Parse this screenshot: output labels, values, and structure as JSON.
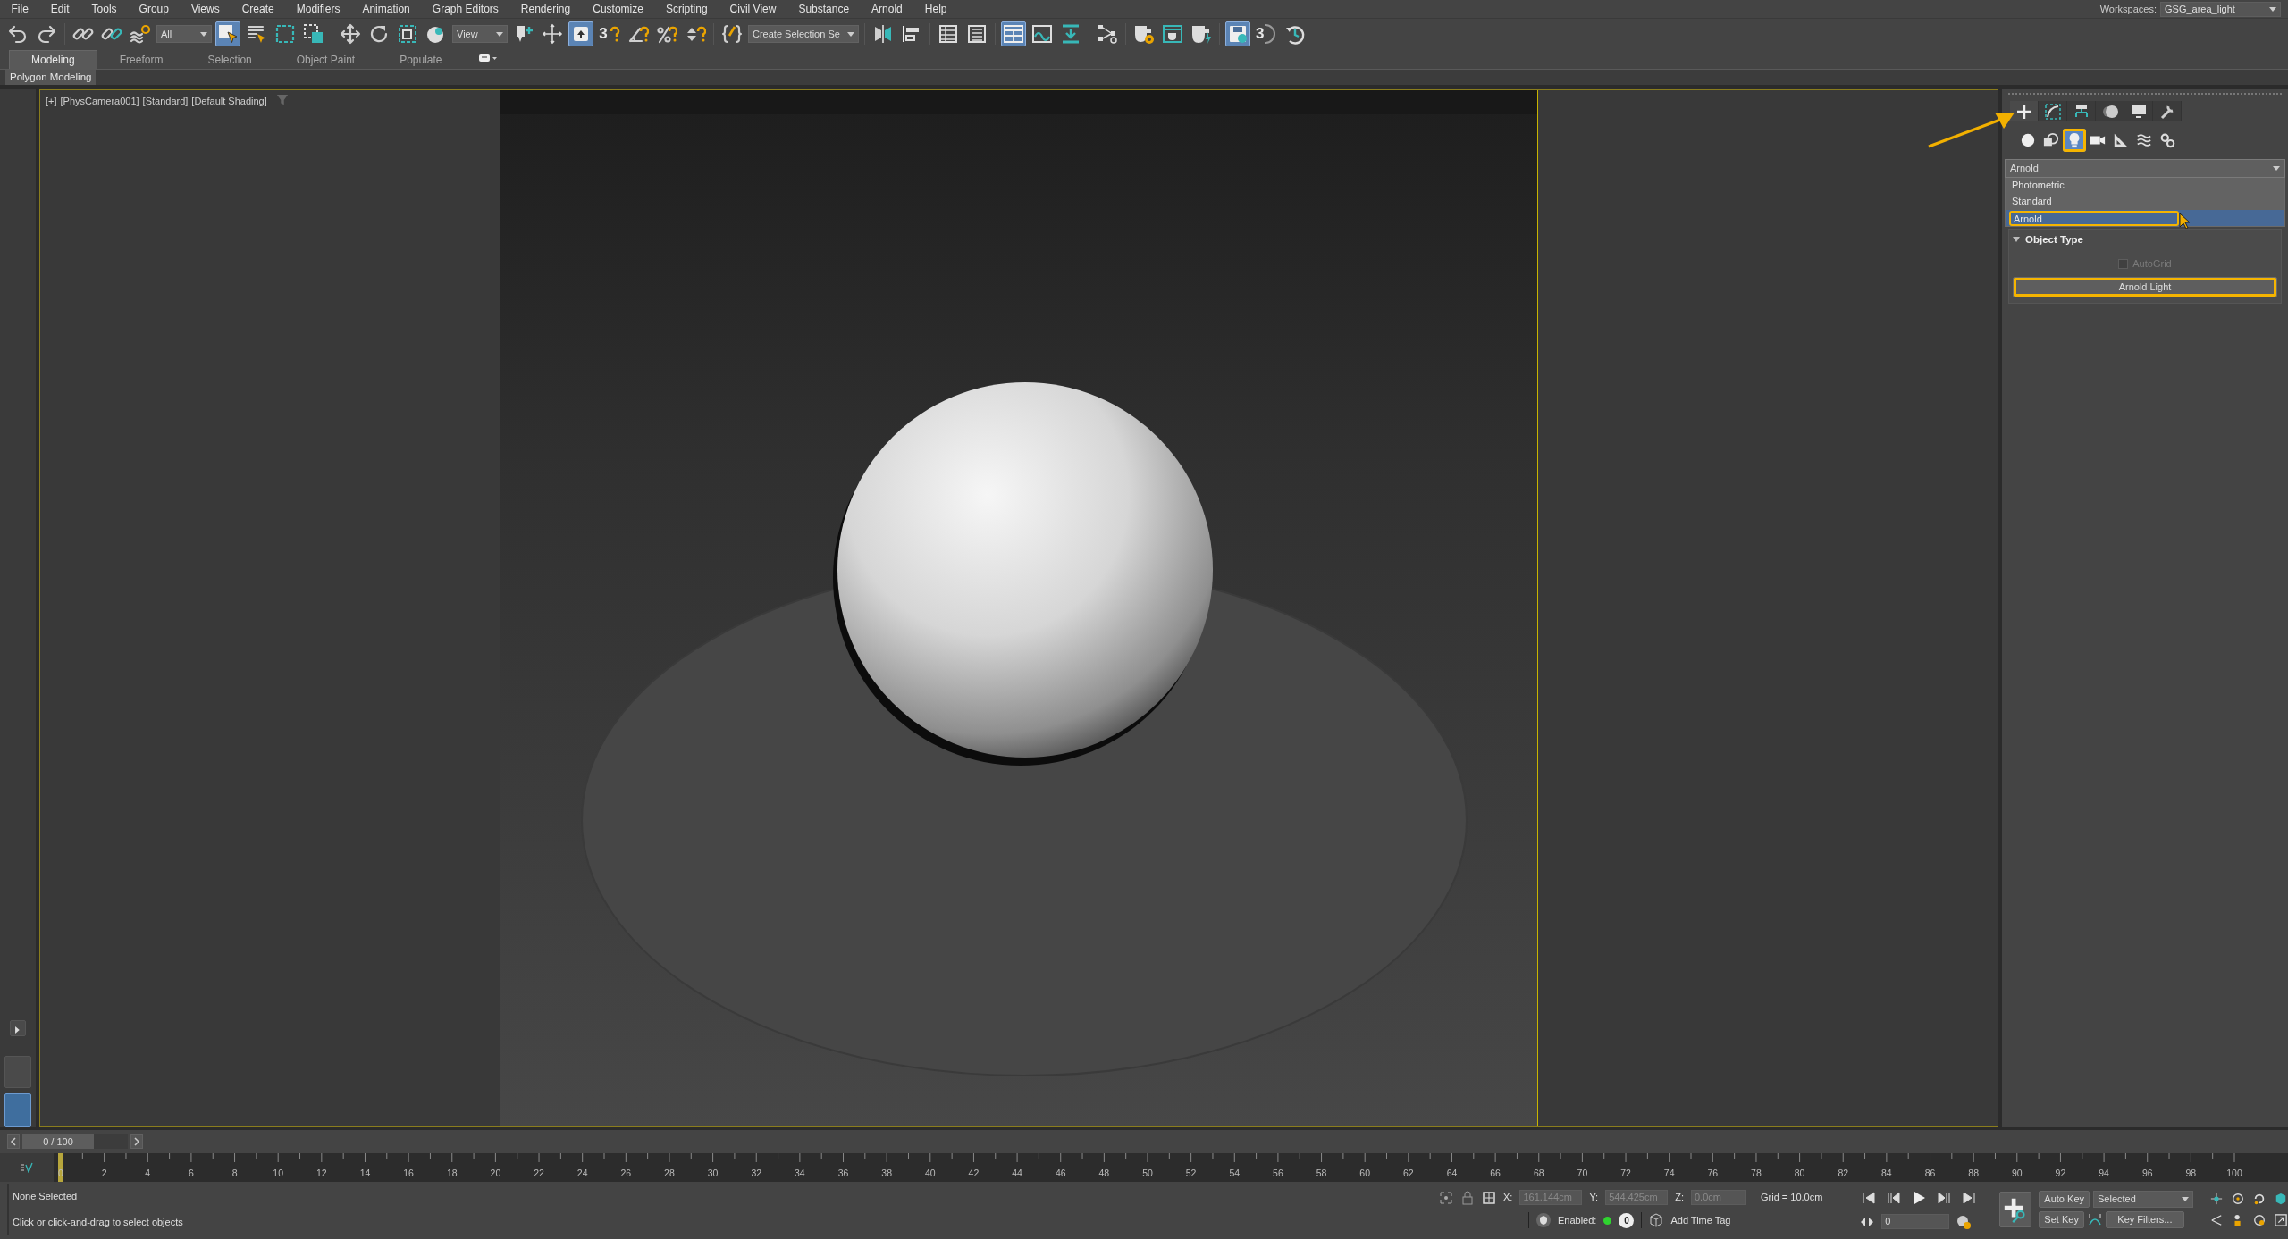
{
  "menu": [
    "File",
    "Edit",
    "Tools",
    "Group",
    "Views",
    "Create",
    "Modifiers",
    "Animation",
    "Graph Editors",
    "Rendering",
    "Customize",
    "Scripting",
    "Civil View",
    "Substance",
    "Arnold",
    "Help"
  ],
  "workspaces": {
    "label": "Workspaces:",
    "value": "GSG_area_light"
  },
  "toolbar": [
    {
      "kind": "button",
      "active": false
    },
    {
      "kind": "button",
      "active": false
    },
    {
      "kind": "separator"
    },
    {
      "kind": "button",
      "active": false
    },
    {
      "kind": "button",
      "active": false
    },
    {
      "kind": "button",
      "active": false
    },
    {
      "kind": "dropdown",
      "value": "All"
    },
    {
      "kind": "button",
      "active": true
    },
    {
      "kind": "button",
      "active": false
    },
    {
      "kind": "button",
      "active": false
    },
    {
      "kind": "button",
      "active": false
    },
    {
      "kind": "separator"
    },
    {
      "kind": "button",
      "active": false
    },
    {
      "kind": "button",
      "active": false
    },
    {
      "kind": "button",
      "active": false
    },
    {
      "kind": "button",
      "active": false
    },
    {
      "kind": "dropdown",
      "value": "View"
    },
    {
      "kind": "button",
      "active": false
    },
    {
      "kind": "button",
      "active": false
    },
    {
      "kind": "button",
      "active": true
    },
    {
      "kind": "button",
      "active": false,
      "label": "3"
    },
    {
      "kind": "button",
      "active": false
    },
    {
      "kind": "button",
      "active": false
    },
    {
      "kind": "button",
      "active": false
    },
    {
      "kind": "separator"
    },
    {
      "kind": "button",
      "active": false
    },
    {
      "kind": "dropdown",
      "value": "Create Selection Se"
    },
    {
      "kind": "separator"
    },
    {
      "kind": "button",
      "active": false
    },
    {
      "kind": "button",
      "active": false
    },
    {
      "kind": "separator"
    },
    {
      "kind": "button",
      "active": false
    },
    {
      "kind": "button",
      "active": false
    },
    {
      "kind": "separator"
    },
    {
      "kind": "button",
      "active": true
    },
    {
      "kind": "button",
      "active": false
    },
    {
      "kind": "button",
      "active": false
    },
    {
      "kind": "separator"
    },
    {
      "kind": "button",
      "active": false
    },
    {
      "kind": "separator"
    },
    {
      "kind": "button",
      "active": false
    },
    {
      "kind": "button",
      "active": false
    },
    {
      "kind": "button",
      "active": false
    },
    {
      "kind": "separator"
    },
    {
      "kind": "button",
      "active": true
    },
    {
      "kind": "button",
      "active": false,
      "label": "3"
    },
    {
      "kind": "button",
      "active": false
    }
  ],
  "ribbon_tabs": [
    {
      "label": "Modeling",
      "selected": true
    },
    {
      "label": "Freeform",
      "selected": false
    },
    {
      "label": "Selection",
      "selected": false
    },
    {
      "label": "Object Paint",
      "selected": false
    },
    {
      "label": "Populate",
      "selected": false
    }
  ],
  "ribbon_panel": {
    "label": "Polygon Modeling"
  },
  "viewport": {
    "labels": [
      "[+]",
      "[PhysCamera001]",
      "[Standard]",
      "[Default Shading]"
    ]
  },
  "command_panel": {
    "tabs": [
      {
        "selected": true
      },
      {
        "selected": false
      },
      {
        "selected": false
      },
      {
        "selected": false
      },
      {
        "selected": false
      },
      {
        "selected": false
      }
    ],
    "categories": [
      {
        "selected": false,
        "highlighted": false
      },
      {
        "selected": false,
        "highlighted": false
      },
      {
        "selected": true,
        "highlighted": true
      },
      {
        "selected": false,
        "highlighted": false
      },
      {
        "selected": false,
        "highlighted": false
      },
      {
        "selected": false,
        "highlighted": false
      },
      {
        "selected": false,
        "highlighted": false
      }
    ],
    "dropdown": {
      "value": "Arnold",
      "expanded": true
    },
    "options": [
      {
        "label": "Photometric",
        "selected": false,
        "highlighted": false
      },
      {
        "label": "Standard",
        "selected": false,
        "highlighted": false
      },
      {
        "label": "Arnold",
        "selected": true,
        "highlighted": true
      }
    ],
    "rollout": {
      "title": "Object Type",
      "expanded": true
    },
    "autogrid": {
      "label": "AutoGrid",
      "checked": false,
      "disabled": true
    },
    "buttons": [
      {
        "label": "Arnold Light",
        "highlighted": true
      }
    ]
  },
  "time_slider": {
    "label": "0 / 100",
    "level": 0
  },
  "ruler": [
    "0",
    "2",
    "4",
    "6",
    "8",
    "10",
    "12",
    "14",
    "16",
    "18",
    "20",
    "22",
    "24",
    "26",
    "28",
    "30",
    "32",
    "34",
    "36",
    "38",
    "40",
    "42",
    "44",
    "46",
    "48",
    "50",
    "52",
    "54",
    "56",
    "58",
    "60",
    "62",
    "64",
    "66",
    "68",
    "70",
    "72",
    "74",
    "76",
    "78",
    "80",
    "82",
    "84",
    "86",
    "88",
    "90",
    "92",
    "94",
    "96",
    "98",
    "100"
  ],
  "status": {
    "selection": "None Selected",
    "prompt": "Click or click-and-drag to select objects",
    "coords": [
      {
        "axis": "X:",
        "value": "161.144cm"
      },
      {
        "axis": "Y:",
        "value": "544.425cm"
      },
      {
        "axis": "Z:",
        "value": "0.0cm"
      }
    ],
    "grid": "Grid = 10.0cm",
    "enabled_label": "Enabled:",
    "enabled_on": true,
    "tag_count": "0",
    "add_time_tag": "Add Time Tag",
    "current_frame": "0",
    "auto_key": "Auto Key",
    "key_mode": "Selected",
    "set_key": "Set Key",
    "key_filters": "Key Filters..."
  }
}
